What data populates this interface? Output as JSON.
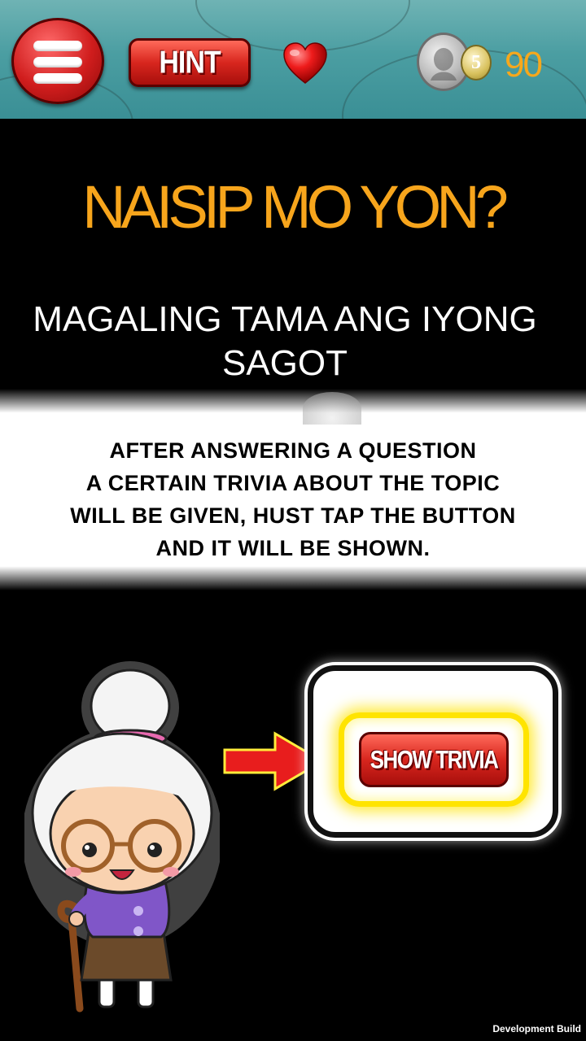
{
  "header": {
    "menu_icon": "hamburger-menu-icon",
    "hint_label": "HINT",
    "life_icon": "heart-icon",
    "coin_icon": "peso-coin-icon",
    "coin_denomination": "5",
    "coin_count": "90",
    "accent_color": "#f6a81c"
  },
  "main": {
    "title": "NAISIP MO YON?",
    "result_message": "MAGALING TAMA ANG IYONG SAGOT"
  },
  "tutorial": {
    "instruction_lines": [
      "AFTER ANSWERING A QUESTION",
      "A CERTAIN TRIVIA ABOUT THE TOPIC",
      "WILL BE GIVEN, HUST TAP THE BUTTON",
      "AND IT WILL BE SHOWN."
    ],
    "show_trivia_label": "SHOW TRIVIA",
    "character_icon": "grandma-character-icon",
    "pointer_icon": "red-arrow-icon"
  },
  "footer": {
    "build_label": "Development Build"
  }
}
